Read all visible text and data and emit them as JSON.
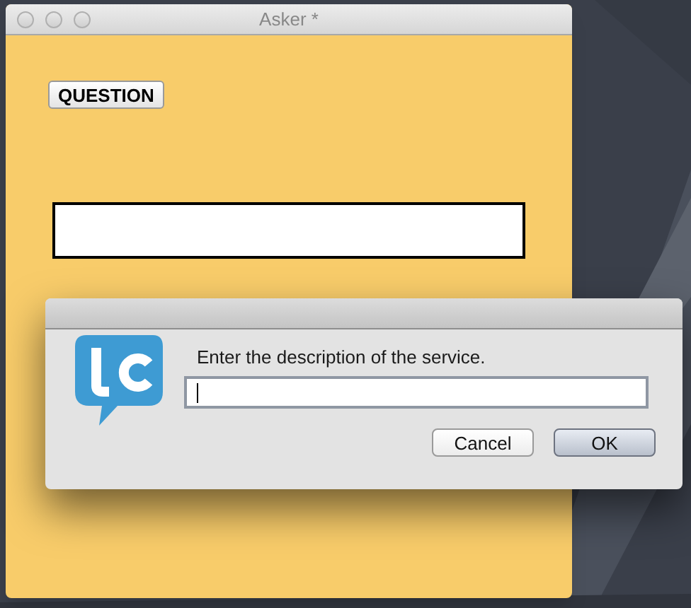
{
  "window": {
    "title": "Asker *"
  },
  "question_button": {
    "label": "QUESTION"
  },
  "dialog": {
    "message": "Enter the description of the service.",
    "field": {
      "focused": true
    },
    "buttons": [
      {
        "label": "Cancel",
        "default": false
      },
      {
        "label": "OK",
        "default": true
      }
    ]
  }
}
